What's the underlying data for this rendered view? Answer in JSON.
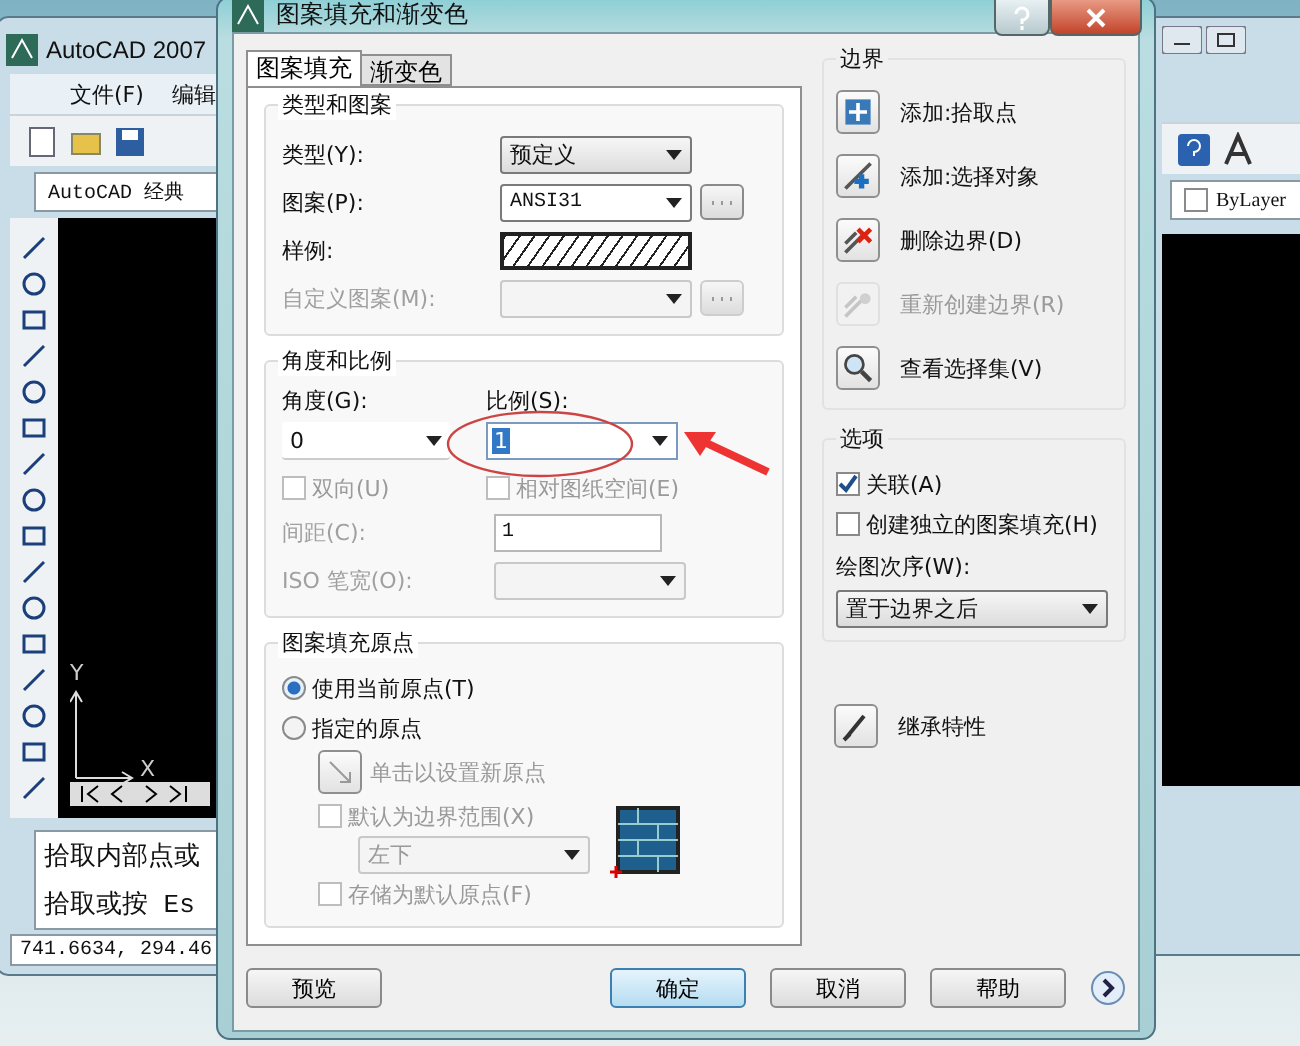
{
  "background_window": {
    "title": "AutoCAD 2007",
    "menu": [
      "文件(F)",
      "编辑"
    ],
    "workspace": "AutoCAD 经典",
    "ucs_labels": {
      "y": "Y",
      "x": "X"
    },
    "command_lines": [
      "拾取内部点或",
      "拾取或按 Es"
    ],
    "coordinates": "741.6634,  294.46"
  },
  "right_window": {
    "layer": "ByLayer"
  },
  "dialog": {
    "title": "图案填充和渐变色",
    "tabs": [
      {
        "label": "图案填充",
        "selected": true
      },
      {
        "label": "渐变色",
        "selected": false
      }
    ],
    "type_and_pattern": {
      "title": "类型和图案",
      "rows": [
        {
          "kind": "select",
          "label": "类型(Y):",
          "value": "预定义",
          "disabled": false,
          "browse": false
        },
        {
          "kind": "select",
          "label": "图案(P):",
          "value": "ANSI31",
          "disabled": false,
          "browse": true
        },
        {
          "kind": "swatch",
          "label": "样例:",
          "disabled": false
        },
        {
          "kind": "select",
          "label": "自定义图案(M):",
          "disabled": true,
          "browse": true
        }
      ]
    },
    "angle_and_scale": {
      "title": "角度和比例",
      "angle": {
        "label": "角度(G):",
        "value": "0"
      },
      "scale": {
        "label": "比例(S):",
        "value": "1"
      },
      "checks": [
        {
          "label": "双向(U)",
          "checked": false,
          "disabled": true
        },
        {
          "label": "相对图纸空间(E)",
          "checked": false,
          "disabled": true
        }
      ],
      "spacing": {
        "label": "间距(C):",
        "value": "1",
        "disabled": true
      },
      "iso_pen": {
        "label": "ISO 笔宽(O):",
        "disabled": true
      }
    },
    "origin": {
      "title": "图案填充原点",
      "radios": [
        {
          "label": "使用当前原点(T)",
          "selected": true
        },
        {
          "label": "指定的原点",
          "selected": false
        }
      ],
      "set_button": {
        "label": "单击以设置新原点",
        "disabled": true
      },
      "default_extent": {
        "label": "默认为边界范围(X)",
        "checked": false,
        "disabled": true
      },
      "position": {
        "value": "左下",
        "disabled": true
      },
      "store_default": {
        "label": "存储为默认原点(F)",
        "checked": false,
        "disabled": true
      }
    },
    "boundaries": {
      "title": "边界",
      "buttons": [
        {
          "kind": "pick",
          "label": "添加:拾取点",
          "disabled": false
        },
        {
          "kind": "select",
          "label": "添加:选择对象",
          "disabled": false
        },
        {
          "kind": "remove",
          "label": "删除边界(D)",
          "disabled": false
        },
        {
          "kind": "recreate",
          "label": "重新创建边界(R)",
          "disabled": true
        },
        {
          "kind": "view",
          "label": "查看选择集(V)",
          "disabled": false
        }
      ]
    },
    "options": {
      "title": "选项",
      "checks": [
        {
          "label": "关联(A)",
          "checked": true
        },
        {
          "label": "创建独立的图案填充(H)",
          "checked": false
        }
      ],
      "draw_order": {
        "label": "绘图次序(W):",
        "value": "置于边界之后"
      }
    },
    "inherit": {
      "label": "继承特性"
    },
    "footer": [
      {
        "label": "预览",
        "default": false
      },
      {
        "label": "确定",
        "default": true
      },
      {
        "label": "取消",
        "default": false
      },
      {
        "label": "帮助",
        "default": false
      }
    ]
  }
}
